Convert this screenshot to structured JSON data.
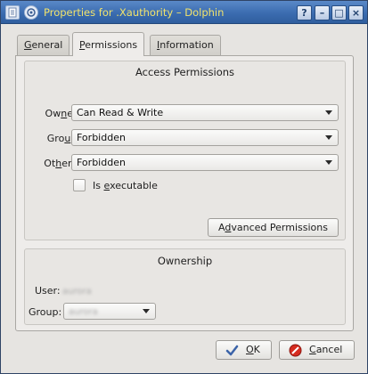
{
  "window": {
    "title": "Properties for .Xauthority – Dolphin",
    "help_label": "?",
    "minimize_label": "–",
    "maximize_label": "□",
    "close_label": "×"
  },
  "tabs": [
    {
      "label": "General",
      "mnemonic": "G",
      "rest": "eneral"
    },
    {
      "label": "Permissions",
      "mnemonic": "P",
      "rest": "ermissions",
      "active": true
    },
    {
      "label": "Information",
      "mnemonic": "I",
      "rest": "nformation"
    }
  ],
  "access": {
    "title": "Access Permissions",
    "owner": {
      "label_pre": "Ow",
      "label_mn": "n",
      "label_post": "er:",
      "value": "Can Read & Write"
    },
    "group": {
      "label_pre": "Gro",
      "label_mn": "u",
      "label_post": "p:",
      "value": "Forbidden"
    },
    "others": {
      "label_pre": "Ot",
      "label_mn": "h",
      "label_post": "ers:",
      "value": "Forbidden"
    },
    "executable": {
      "label_pre": "Is ",
      "label_mn": "e",
      "label_post": "xecutable",
      "checked": false
    },
    "advanced": {
      "label_pre": "A",
      "label_mn": "d",
      "label_post": "vanced Permissions"
    }
  },
  "ownership": {
    "title": "Ownership",
    "user_label": "User:",
    "user_value": "aurora",
    "group_label": "Group:",
    "group_value": "aurora"
  },
  "buttons": {
    "ok": {
      "label_mn": "O",
      "label_post": "K"
    },
    "cancel": {
      "label_mn": "C",
      "label_post": "ancel"
    }
  }
}
